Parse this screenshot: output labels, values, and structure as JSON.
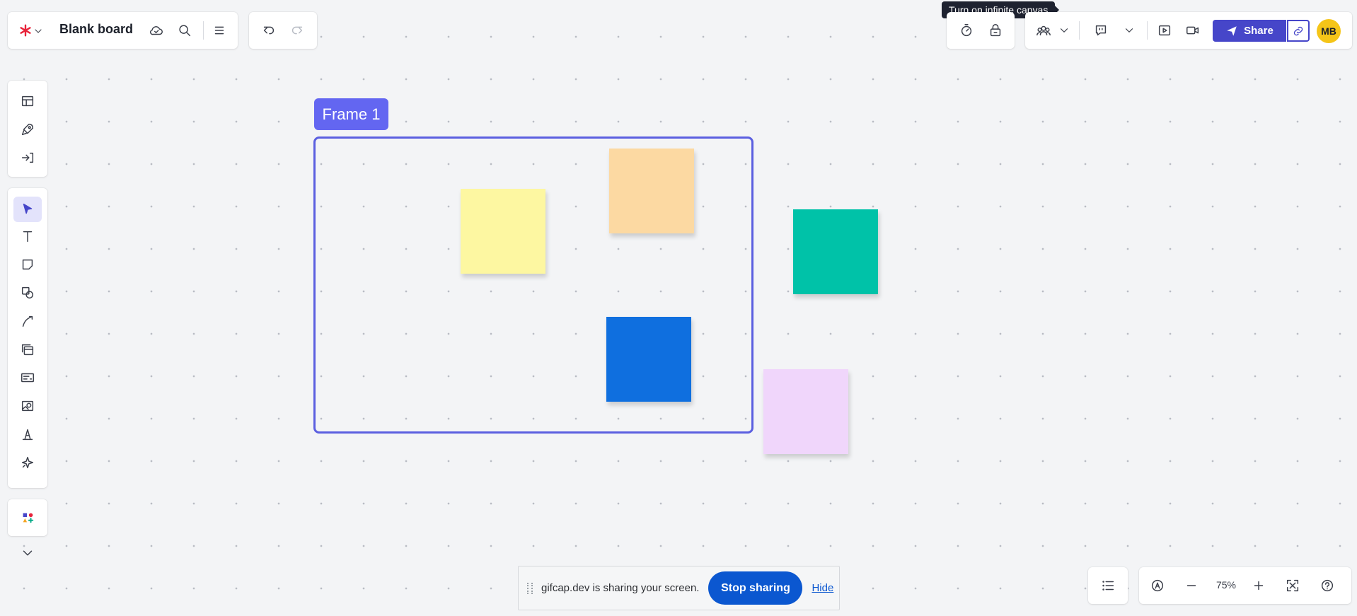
{
  "header": {
    "app_logo": "lucid-asterisk-icon",
    "board_title": "Blank board",
    "icons": [
      "chevron-down-icon",
      "cloud-saved-icon",
      "search-icon",
      "menu-icon",
      "undo-icon",
      "redo-icon"
    ]
  },
  "tooltip": {
    "text": "Turn on infinite canvas"
  },
  "top_right": {
    "icons": [
      "timer-icon",
      "lock-board-icon",
      "collaborators-icon",
      "chevron-down-icon",
      "comment-icon",
      "chevron-down-icon",
      "present-icon",
      "video-call-icon"
    ],
    "share_label": "Share",
    "copy_link_icon": "link-icon",
    "avatar_initials": "MB"
  },
  "left_toolbar": {
    "top_group": [
      "templates-icon",
      "quick-start-icon",
      "import-icon"
    ],
    "tools": [
      "select-pointer-icon",
      "text-icon",
      "sticky-note-icon",
      "shapes-icon",
      "connector-icon",
      "container-icon",
      "card-icon",
      "image-icon",
      "draw-icon",
      "ai-sparkle-icon"
    ],
    "bottom": [
      "more-shapes-icon",
      "chevron-down-icon"
    ]
  },
  "canvas": {
    "frame": {
      "label": "Frame 1",
      "border_color": "#5b5fe0",
      "label_color": "#6366f1"
    },
    "stickies": [
      {
        "name": "yellow",
        "color": "#fdf7a1"
      },
      {
        "name": "orange",
        "color": "#fcd9a2"
      },
      {
        "name": "teal",
        "color": "#00c2a8"
      },
      {
        "name": "blue",
        "color": "#0f6fdf"
      },
      {
        "name": "lavender",
        "color": "#f0d6fb"
      }
    ]
  },
  "screen_share": {
    "message": "gifcap.dev is sharing your screen.",
    "stop_label": "Stop sharing",
    "hide_label": "Hide"
  },
  "bottom_right": {
    "zoom": "75%",
    "icons": [
      "outline-list-icon",
      "navigator-icon",
      "zoom-out-icon",
      "zoom-in-icon",
      "fit-screen-icon",
      "help-icon"
    ]
  },
  "colors": {
    "accent": "#4646c9",
    "avatar": "#f5c518",
    "canvas_bg": "#f3f4f6"
  }
}
